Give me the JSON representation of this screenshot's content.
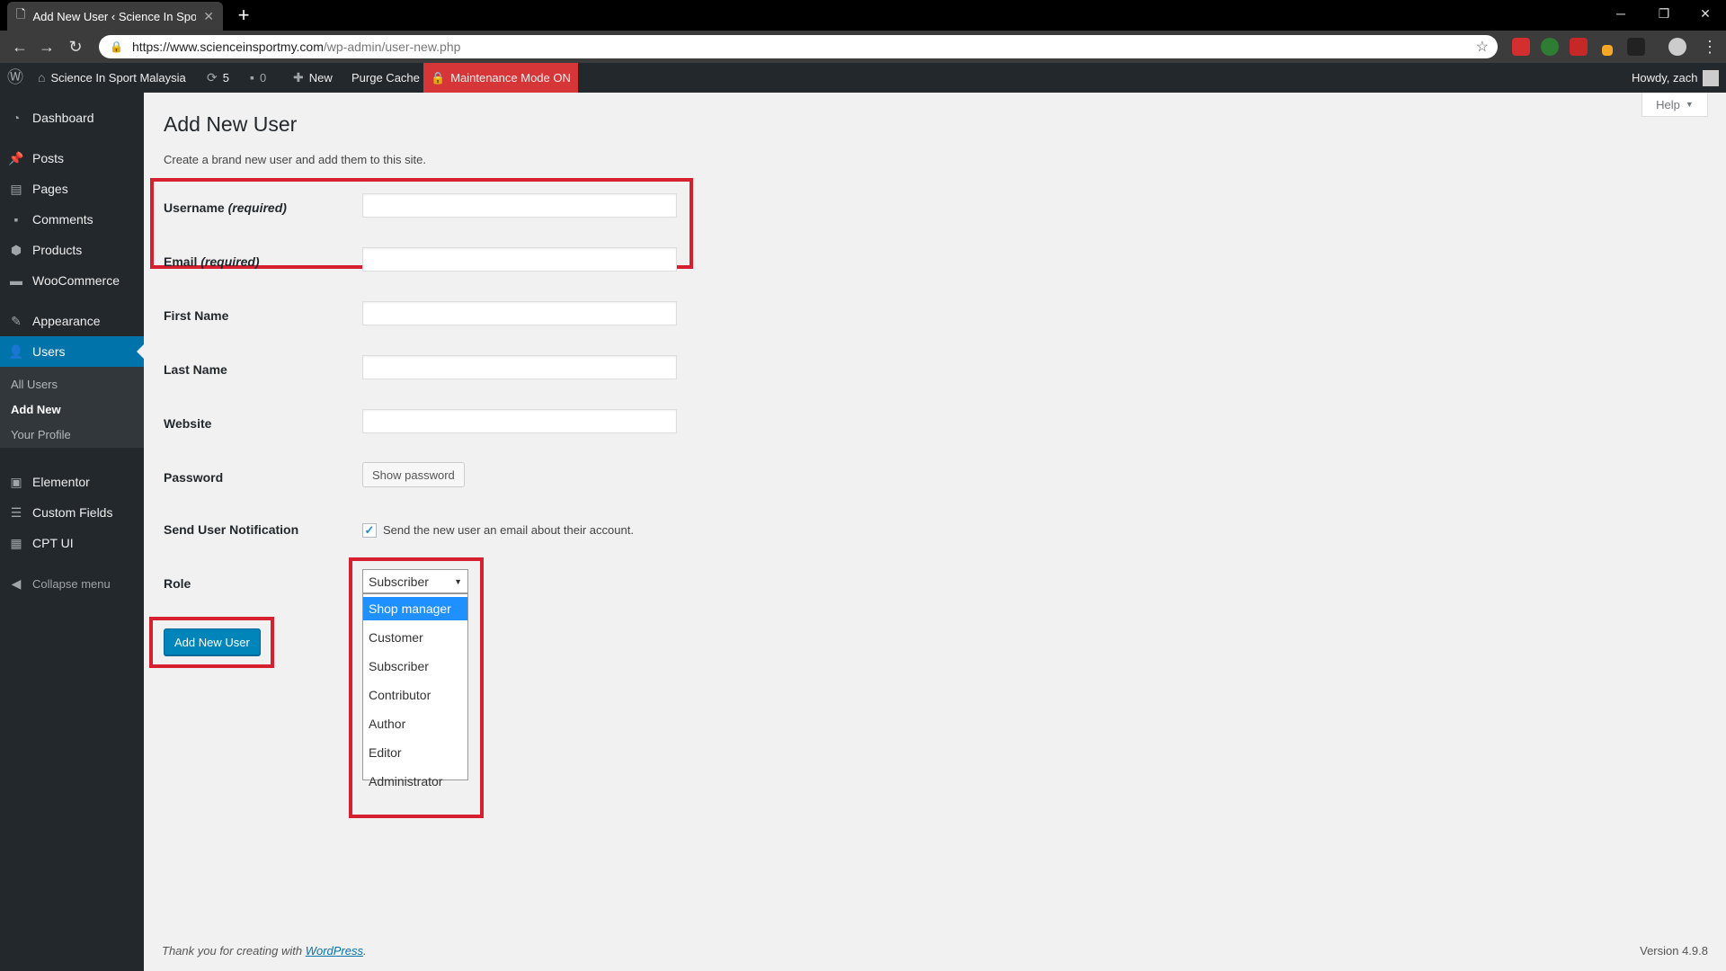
{
  "browser": {
    "tab_title": "Add New User ‹ Science In Sport",
    "new_tab": "+",
    "url_host": "https://www.scienceinsportmy.com",
    "url_path": "/wp-admin/user-new.php"
  },
  "adminbar": {
    "site_name": "Science In Sport Malaysia",
    "updates_count": "5",
    "comments_count": "0",
    "new_label": "New",
    "purge_cache": "Purge Cache",
    "maintenance": "Maintenance Mode ON",
    "howdy": "Howdy, zach"
  },
  "sidebar": {
    "items": [
      {
        "label": "Dashboard",
        "icon": "dashboard-icon"
      },
      {
        "label": "Posts",
        "icon": "pin-icon"
      },
      {
        "label": "Pages",
        "icon": "pages-icon"
      },
      {
        "label": "Comments",
        "icon": "comment-icon"
      },
      {
        "label": "Products",
        "icon": "products-icon"
      },
      {
        "label": "WooCommerce",
        "icon": "woocommerce-icon"
      },
      {
        "label": "Appearance",
        "icon": "brush-icon"
      },
      {
        "label": "Users",
        "icon": "user-icon"
      },
      {
        "label": "Elementor",
        "icon": "elementor-icon"
      },
      {
        "label": "Custom Fields",
        "icon": "fields-icon"
      },
      {
        "label": "CPT UI",
        "icon": "grid-icon"
      }
    ],
    "submenu": [
      "All Users",
      "Add New",
      "Your Profile"
    ],
    "collapse": "Collapse menu"
  },
  "main": {
    "help": "Help",
    "title": "Add New User",
    "description": "Create a brand new user and add them to this site.",
    "fields": {
      "username_label": "Username",
      "email_label": "Email",
      "required": "(required)",
      "first_name_label": "First Name",
      "last_name_label": "Last Name",
      "website_label": "Website",
      "password_label": "Password",
      "show_password": "Show password",
      "notification_label": "Send User Notification",
      "notification_text": "Send the new user an email about their account.",
      "notification_checked": true,
      "role_label": "Role",
      "role_selected": "Subscriber",
      "role_options": [
        "Shop manager",
        "Customer",
        "Subscriber",
        "Contributor",
        "Author",
        "Editor",
        "Administrator"
      ],
      "role_highlighted": "Shop manager"
    },
    "submit": "Add New User"
  },
  "footer": {
    "thanks_prefix": "Thank you for creating with",
    "thanks_link": "WordPress",
    "thanks_suffix": ".",
    "version": "Version 4.9.8"
  },
  "colors": {
    "highlight_box": "#d6202f",
    "primary": "#0085ba",
    "sidebar_active": "#0073aa",
    "maintenance": "#d63638"
  }
}
